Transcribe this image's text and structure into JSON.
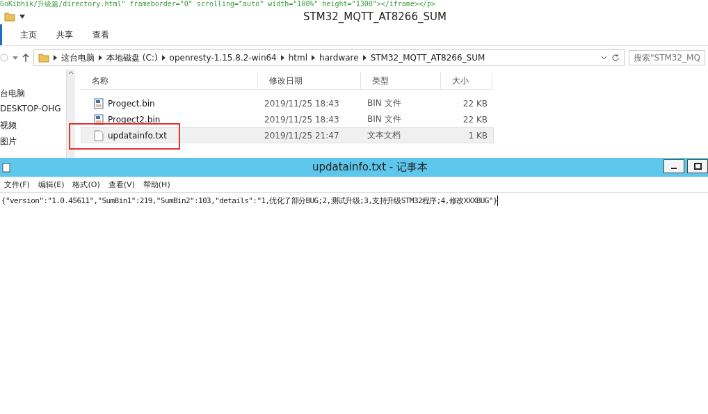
{
  "background_code": {
    "text": "GoKibhik/升级篇/directory.html\" frameborder=\"0\" scrolling=\"auto\" width=\"100%\" height=\"1300\"></iframe></p>"
  },
  "explorer": {
    "title": "STM32_MQTT_AT8266_SUM",
    "ribbon_tabs": [
      {
        "label": "主页",
        "selected": false
      },
      {
        "label": "共享",
        "selected": false
      },
      {
        "label": "查看",
        "selected": false
      }
    ],
    "breadcrumbs": [
      "这台电脑",
      "本地磁盘 (C:)",
      "openresty-1.15.8.2-win64",
      "html",
      "hardware",
      "STM32_MQTT_AT8266_SUM"
    ],
    "search": {
      "placeholder": "搜索\"STM32_MQ"
    },
    "sidebar": {
      "items": [
        "台电脑",
        "DESKTOP-OHG",
        "视频",
        "图片"
      ]
    },
    "table": {
      "columns": [
        "名称",
        "修改日期",
        "类型",
        "大小"
      ],
      "rows": [
        {
          "kind": "bin",
          "name": "Progect.bin",
          "date": "2019/11/25 18:43",
          "type": "BIN 文件",
          "size": "22 KB",
          "selected": false,
          "highlighted": false
        },
        {
          "kind": "bin",
          "name": "Progect2.bin",
          "date": "2019/11/25 18:43",
          "type": "BIN 文件",
          "size": "22 KB",
          "selected": false,
          "highlighted": false
        },
        {
          "kind": "txt",
          "name": "updatainfo.txt",
          "date": "2019/11/25 21:47",
          "type": "文本文档",
          "size": "1 KB",
          "selected": true,
          "highlighted": true
        }
      ]
    }
  },
  "notepad": {
    "title": "updatainfo.txt - 记事本",
    "menu": [
      "文件(F)",
      "编辑(E)",
      "格式(O)",
      "查看(V)",
      "帮助(H)"
    ],
    "content": "{\"version\":\"1.0.45611\",\"SumBin1\":219,\"SumBin2\":103,\"details\":\"1,优化了部分BUG;2,测试升级;3,支持升级STM32程序;4,修改XXXBUG\"}"
  }
}
